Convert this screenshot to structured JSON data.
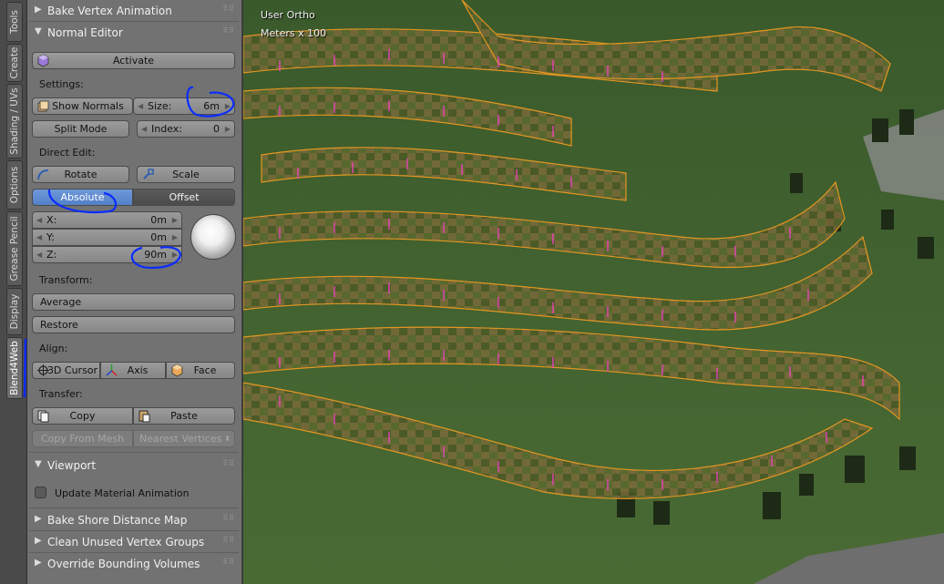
{
  "tabs": [
    "Tools",
    "Create",
    "Shading / UVs",
    "Options",
    "Grease Pencil",
    "Display",
    "Blend4Web"
  ],
  "panels": {
    "bake_vertex_animation": "Bake Vertex Animation",
    "normal_editor": "Normal Editor",
    "viewport": "Viewport",
    "bake_shore": "Bake Shore Distance Map",
    "clean_unused": "Clean Unused Vertex Groups",
    "override_bounding": "Override Bounding Volumes"
  },
  "normal_editor": {
    "activate": "Activate",
    "settings_label": "Settings:",
    "show_normals": "Show Normals",
    "size_label": "Size:",
    "size_value": "6m",
    "split_mode": "Split Mode",
    "index_label": "Index:",
    "index_value": "0",
    "direct_edit_label": "Direct Edit:",
    "rotate": "Rotate",
    "scale": "Scale",
    "absolute": "Absolute",
    "offset": "Offset",
    "x_label": "X:",
    "x_value": "0m",
    "y_label": "Y:",
    "y_value": "0m",
    "z_label": "Z:",
    "z_value": "90m",
    "transform_label": "Transform:",
    "average": "Average",
    "restore": "Restore",
    "align_label": "Align:",
    "cursor_3d": "3D Cursor",
    "axis": "Axis",
    "face": "Face",
    "transfer_label": "Transfer:",
    "copy": "Copy",
    "paste": "Paste",
    "copy_from_mesh": "Copy From Mesh",
    "nearest_vertices": "Nearest Vertices"
  },
  "viewport_panel": {
    "update_material_animation": "Update Material Animation"
  },
  "view3d": {
    "view_name": "User Ortho",
    "scale": "Meters x 100"
  },
  "colors": {
    "panel_bg": "#727272",
    "button": "#8f8f8f",
    "accent_blue": "#5680c8",
    "mesh_orange": "#ffa020",
    "normal_pink": "#ff3cd0",
    "annotation_blue": "#0a2cff"
  }
}
